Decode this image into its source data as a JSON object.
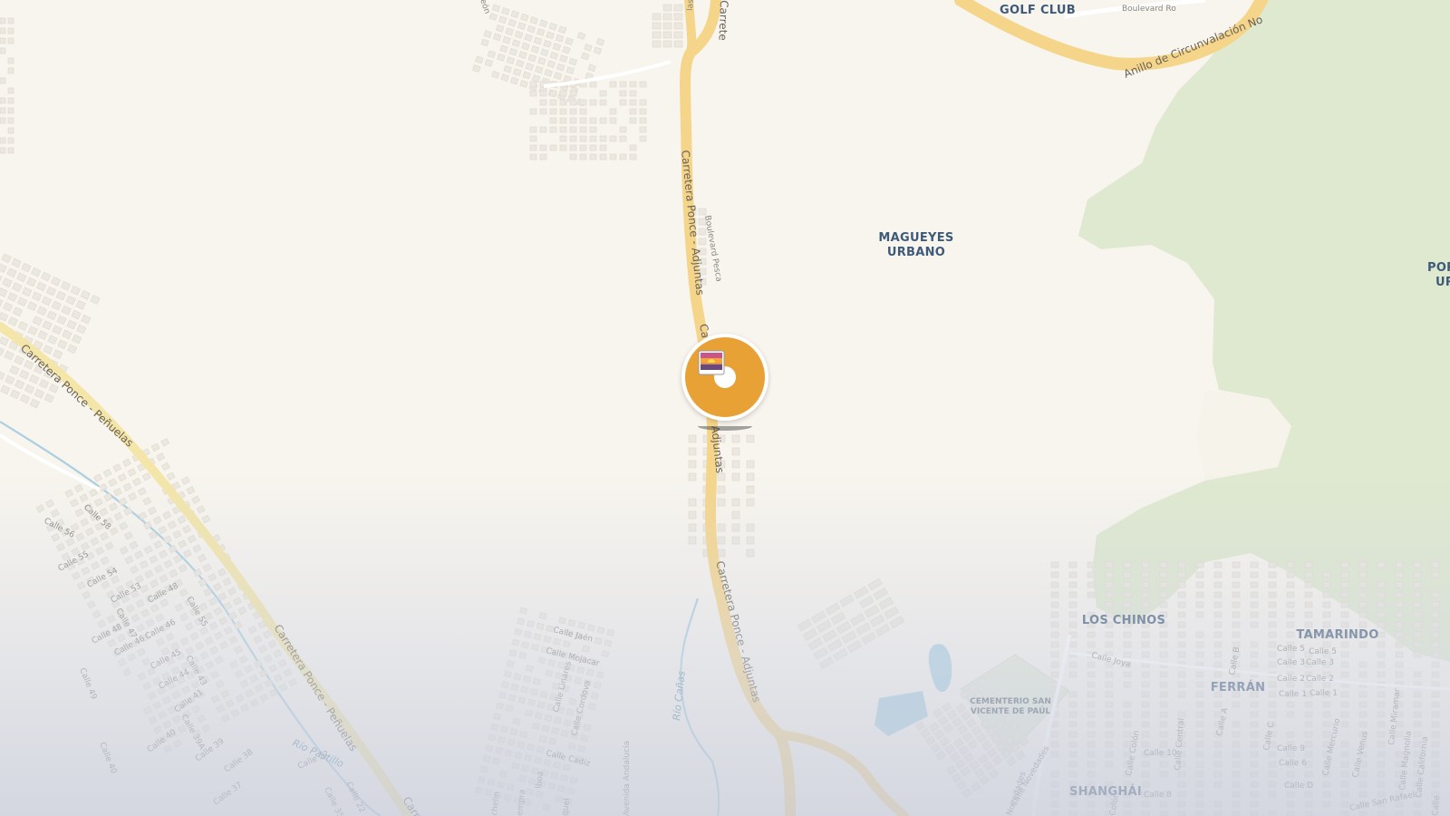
{
  "map": {
    "colors": {
      "land": "#f8f5ee",
      "park": "#dfe9cf",
      "major_road": "#f5d58a",
      "secondary_road": "#f3e6a8",
      "water": "#a9cfe0",
      "pin": "#e8a135"
    },
    "places": {
      "golf_club": "GOLF CLUB",
      "magueyes_line1": "MAGUEYES",
      "magueyes_line2": "URBANO",
      "por_line1": "POR",
      "por_line2": "UR",
      "los_chinos": "LOS CHINOS",
      "tamarindo": "TAMARINDO",
      "ferran": "FERRÁN",
      "shanghai": "SHANGHÁI",
      "cementerio_line1": "CEMENTERIO SAN",
      "cementerio_line2": "VICENTE DE PAÚL"
    },
    "roads": {
      "ponce_adjuntas": "Carretera Ponce - Adjuntas",
      "ponce_adjuntas_short": "Ca",
      "adjuntas_fragment": "Adjuntas",
      "ponce_adjuntas_lower": "Carretera Ponce - Adjuntas",
      "ponce_penuelas": "Carretera Ponce - Peñuelas",
      "ponce_penuelas_lower": "Carretera Ponce - Peñuelas",
      "carre_fragment": "Carrete",
      "carre_bottom": "Carret",
      "anillo": "Anillo de Circunvalación No",
      "boulevard_top": "Boulevard Ro",
      "boulevard_pesca": "Boulevard Pesca",
      "avenida_andalucia": "Avenida Andalucía",
      "calle_novedades": "Calle Novedades",
      "novedades_fragment": "Novedades",
      "las_fragment": "las",
      "leon_fragment": "eón"
    },
    "water": {
      "rio_canas": "Río Cañas",
      "rio_pastillo": "Río Pastillo"
    },
    "streets": {
      "calle_56": "Calle 56",
      "calle_58": "Calle 58",
      "calle_55": "Calle 55",
      "calle_54": "Calle 54",
      "calle_53": "Calle 53",
      "calle_48": "Calle 48",
      "calle_47": "Calle 47",
      "calle_46a": "Calle 46",
      "calle_46b": "Calle 46",
      "calle_48b": "Calle 48",
      "calle_55b": "Calle 55",
      "calle_49": "Calle 49",
      "calle_45": "Calle 45",
      "calle_44": "Calle 44",
      "calle_43": "Calle 43",
      "calle_41": "Calle 41",
      "calle_40": "Calle 40",
      "calle_40b": "Calle 40",
      "calle_39a": "Calle 39A",
      "calle_39": "Calle 39",
      "calle_38": "Calle 38",
      "calle_37": "Calle 37",
      "calle_22": "Calle 22",
      "calle_22b": "Calle 22",
      "calle_35": "Calle 35",
      "calle_jaen": "Calle Jaén",
      "calle_mojacar": "Calle Mojacar",
      "calle_linares": "Calle Linares",
      "calle_cordova": "Calle Cordova",
      "calle_cadiz": "Calle Cadiz",
      "calle_joya": "Calle Joya",
      "calle_colon": "Calle Colón",
      "calle_10": "Calle 10",
      "calle_8": "Calle 8",
      "calle_central": "Calle Central",
      "calle_a": "Calle A",
      "calle_b": "Calle B",
      "calle_c": "Calle C",
      "calle_5": "Calle 5",
      "calle_5b": "Calle 5",
      "calle_3": "Calle 3",
      "calle_3b": "Calle 3",
      "calle_2": "Calle 2",
      "calle_2b": "Calle 2",
      "calle_1": "Calle 1",
      "calle_1b": "Calle 1",
      "calle_9": "Calle 9",
      "calle_6": "Calle 6",
      "calle_d": "Calle D",
      "calle_mercurio": "Calle Mercurio",
      "calle_venus": "Calle Venus",
      "calle_miramar": "Calle Miramar",
      "calle_magnolia": "Calle Magnolia",
      "calle_california": "Calle California",
      "calle_san_rafael": "Calle San Rafael",
      "calle_cl": "Calle",
      "empra": "empra",
      "lboa": "lboa",
      "quel": "quel",
      "chelin": "chelin",
      "colon_b": "Colón",
      "calle_frag": "Calle"
    }
  },
  "marker": {
    "icon": "sunrise-photo-icon"
  }
}
